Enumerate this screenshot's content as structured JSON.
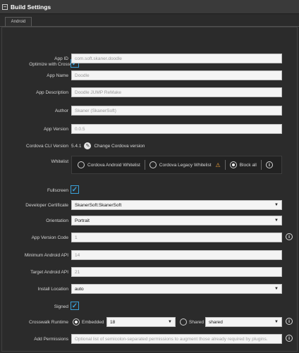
{
  "header": {
    "title": "Build Settings"
  },
  "tabs": [
    {
      "label": "Android"
    }
  ],
  "crosswalk": {
    "label": "Optimize with Crosswalk",
    "checked": true
  },
  "app_id": {
    "label": "App ID",
    "value": "com.soft.skaner.doodle"
  },
  "app_name": {
    "label": "App Name",
    "value": "Doodle"
  },
  "app_description": {
    "label": "App Description",
    "value": "Doodle JUMP ReMake"
  },
  "author": {
    "label": "Author",
    "value": "Skaner (SkanerSoft)"
  },
  "app_version": {
    "label": "App Version",
    "value": "0.0.5"
  },
  "cordova_cli": {
    "label": "Cordova CLI Version",
    "value": "5.4.1",
    "action": "Change Cordova version"
  },
  "whitelist": {
    "label": "Whitelist",
    "options": [
      "Cordova Android Whitelist",
      "Cordova Legacy Whitelist",
      "Block all"
    ],
    "selected": "Block all"
  },
  "fullscreen": {
    "label": "Fullscreen",
    "checked": true
  },
  "developer_certificate": {
    "label": "Developer Certificate",
    "value": "SkanerSoft:SkanerSoft"
  },
  "orientation": {
    "label": "Orientation",
    "value": "Portrait"
  },
  "app_version_code": {
    "label": "App Version Code",
    "value": "1"
  },
  "min_android_api": {
    "label": "Minimum Android API",
    "value": "14"
  },
  "target_android_api": {
    "label": "Target Android API",
    "value": "21"
  },
  "install_location": {
    "label": "Install Location",
    "value": "auto"
  },
  "signed": {
    "label": "Signed",
    "checked": true
  },
  "crosswalk_runtime": {
    "label": "Crosswalk Runtime",
    "embedded_label": "Embedded",
    "embedded_value": "18",
    "shared_label": "Shared",
    "shared_value": "shared",
    "selected": "Embedded"
  },
  "add_permissions": {
    "label": "Add Permissions",
    "placeholder": "Optional list of semicolon-separated permissions to augment those already required by plugins."
  },
  "colors": {
    "background": "#2b2b2b",
    "accent": "#3aa0d8",
    "warning": "#f2a33a"
  }
}
